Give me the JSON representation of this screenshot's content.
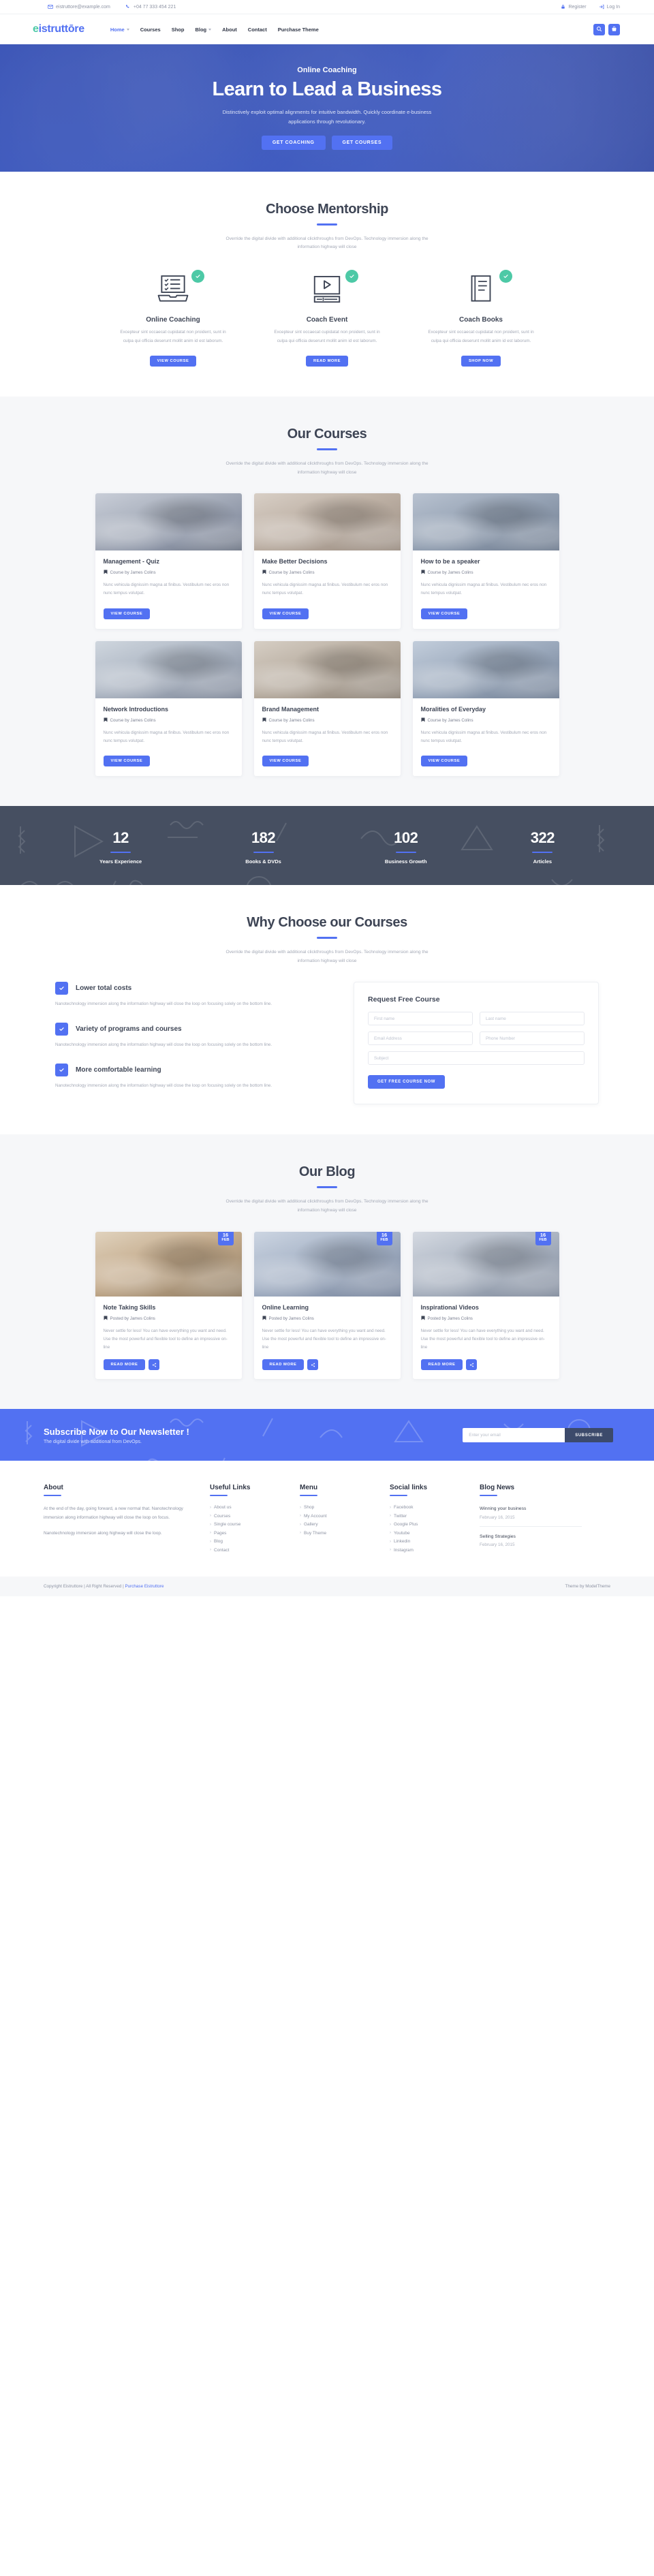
{
  "topbar": {
    "email": "eistruttore@example.com",
    "phone": "+04 77 333 454 221",
    "register": "Register",
    "login": "Log In"
  },
  "header": {
    "logo_first": "e",
    "logo_rest": "istruttōre",
    "nav": [
      {
        "label": "Home",
        "active": true,
        "caret": true
      },
      {
        "label": "Courses",
        "active": false,
        "caret": false
      },
      {
        "label": "Shop",
        "active": false,
        "caret": false
      },
      {
        "label": "Blog",
        "active": false,
        "caret": true
      },
      {
        "label": "About",
        "active": false,
        "caret": false
      },
      {
        "label": "Contact",
        "active": false,
        "caret": false
      },
      {
        "label": "Purchase Theme",
        "active": false,
        "caret": false
      }
    ],
    "search_icon": "search-icon",
    "cart_icon": "cart-icon"
  },
  "hero": {
    "kicker": "Online Coaching",
    "title": "Learn to Lead a Business",
    "subtitle": "Distinctively exploit optimal alignments for intuitive bandwidth. Quickly coordinate e-business applications through revolutionary.",
    "btn1": "GET COACHING",
    "btn2": "GET COURSES"
  },
  "mentorship": {
    "title": "Choose Mentorship",
    "subtitle": "Override the digital divide with additional clickthroughs from DevOps. Technology immersion along the information highway will close",
    "cards": [
      {
        "icon": "laptop-checklist-icon",
        "name": "Online Coaching",
        "desc": "Excepteur sint occaecat cupidatat non proident, sunt in culpa qui officia deserunt mollit anim id est laborum.",
        "button": "VIEW COURSE"
      },
      {
        "icon": "video-play-icon",
        "name": "Coach Event",
        "desc": "Excepteur sint occaecat cupidatat non proident, sunt in culpa qui officia deserunt mollit anim id est laborum.",
        "button": "READ MORE"
      },
      {
        "icon": "book-icon",
        "name": "Coach Books",
        "desc": "Excepteur sint occaecat cupidatat non proident, sunt in culpa qui officia deserunt mollit anim id est laborum.",
        "button": "SHOP NOW"
      }
    ]
  },
  "courses": {
    "title": "Our Courses",
    "subtitle": "Override the digital divide with additional clickthroughs from DevOps. Technology immersion along the information highway will close",
    "items": [
      {
        "title": "Management - Quiz",
        "meta": "Course by James Colins",
        "desc": "Nunc vehicula dignissim magna at finibus. Vestibulum nec eros non nunc tempus volutpat.",
        "button": "VIEW COURSE"
      },
      {
        "title": "Make Better Decisions",
        "meta": "Course by James Colins",
        "desc": "Nunc vehicula dignissim magna at finibus. Vestibulum nec eros non nunc tempus volutpat.",
        "button": "VIEW COURSE"
      },
      {
        "title": "How to be a speaker",
        "meta": "Course by James Colins",
        "desc": "Nunc vehicula dignissim magna at finibus. Vestibulum nec eros non nunc tempus volutpat.",
        "button": "VIEW COURSE"
      },
      {
        "title": "Network Introductions",
        "meta": "Course by James Colins",
        "desc": "Nunc vehicula dignissim magna at finibus. Vestibulum nec eros non nunc tempus volutpat.",
        "button": "VIEW COURSE"
      },
      {
        "title": "Brand Management",
        "meta": "Course by James Colins",
        "desc": "Nunc vehicula dignissim magna at finibus. Vestibulum nec eros non nunc tempus volutpat.",
        "button": "VIEW COURSE"
      },
      {
        "title": "Moralities of Everyday",
        "meta": "Course by James Colins",
        "desc": "Nunc vehicula dignissim magna at finibus. Vestibulum nec eros non nunc tempus volutpat.",
        "button": "VIEW COURSE"
      }
    ]
  },
  "stats": [
    {
      "number": "12",
      "label": "Years Experience"
    },
    {
      "number": "182",
      "label": "Books & DVDs"
    },
    {
      "number": "102",
      "label": "Business Growth"
    },
    {
      "number": "322",
      "label": "Articles"
    }
  ],
  "why": {
    "title": "Why Choose our Courses",
    "subtitle": "Override the digital divide with additional clickthroughs from DevOps. Technology immersion along the information highway will close",
    "items": [
      {
        "title": "Lower total costs",
        "desc": "Nanotechnology immersion along the information highway will close the loop on focusing solely on the bottom line."
      },
      {
        "title": "Variety of programs and courses",
        "desc": "Nanotechnology immersion along the information highway will close the loop on focusing solely on the bottom line."
      },
      {
        "title": "More comfortable learning",
        "desc": "Nanotechnology immersion along the information highway will close the loop on focusing solely on the bottom line."
      }
    ],
    "form": {
      "title": "Request Free Course",
      "first_name": "First name",
      "last_name": "Last name",
      "email": "Email Address",
      "phone": "Phone Number",
      "subject": "Subject",
      "submit": "GET FREE COURSE NOW"
    }
  },
  "blog": {
    "title": "Our Blog",
    "subtitle": "Override the digital divide with additional clickthroughs from DevOps. Technology immersion along the information highway will close",
    "posts": [
      {
        "day": "16",
        "month": "FEB",
        "title": "Note Taking Skills",
        "meta": "Posted by James Colins",
        "desc": "Never settle for less! You can have everything you want and need. Use the most powerful and flexible tool to define an impressive on-line",
        "button": "READ MORE"
      },
      {
        "day": "16",
        "month": "FEB",
        "title": "Online Learning",
        "meta": "Posted by James Colins",
        "desc": "Never settle for less! You can have everything you want and need. Use the most powerful and flexible tool to define an impressive on-line",
        "button": "READ MORE"
      },
      {
        "day": "16",
        "month": "FEB",
        "title": "Inspirational Videos",
        "meta": "Posted by James Colins",
        "desc": "Never settle for less! You can have everything you want and need. Use the most powerful and flexible tool to define an impressive on-line",
        "button": "READ MORE"
      }
    ]
  },
  "newsletter": {
    "title": "Subscribe Now to Our Newsletter !",
    "subtitle": "The digital divide with additional from DevOps.",
    "placeholder": "Enter your email",
    "button": "SUBSCRIBE"
  },
  "footer": {
    "about": {
      "heading": "About",
      "text": "At the end of the day, going forward, a new normal that. Nanotechnology immersion along information highway will close the loop on focus.",
      "text2": "Nanotechnology immersion along highway will close the loop."
    },
    "useful": {
      "heading": "Useful Links",
      "links": [
        "About us",
        "Courses",
        "Single course",
        "Pages",
        "Blog",
        "Contact"
      ]
    },
    "menu": {
      "heading": "Menu",
      "links": [
        "Shop",
        "My Account",
        "Gallery",
        "Buy Theme"
      ]
    },
    "social": {
      "heading": "Social links",
      "links": [
        "Facebook",
        "Twitter",
        "Google Plus",
        "Youtube",
        "Linkedin",
        "Instagram"
      ]
    },
    "blognews": {
      "heading": "Blog News",
      "items": [
        {
          "title": "Winning your business",
          "date": "February 16, 2015"
        },
        {
          "title": "Selling Strategies",
          "date": "February 16, 2015"
        }
      ]
    },
    "copyright_prefix": "Copyright Eistruttore | All Right Reserved | ",
    "copyright_link": "Purchase Eistruttore",
    "credit": "Theme by ModelTheme"
  },
  "colors": {
    "accent": "#5271f2",
    "teal": "#4dc9a6",
    "dark": "#464f61"
  }
}
